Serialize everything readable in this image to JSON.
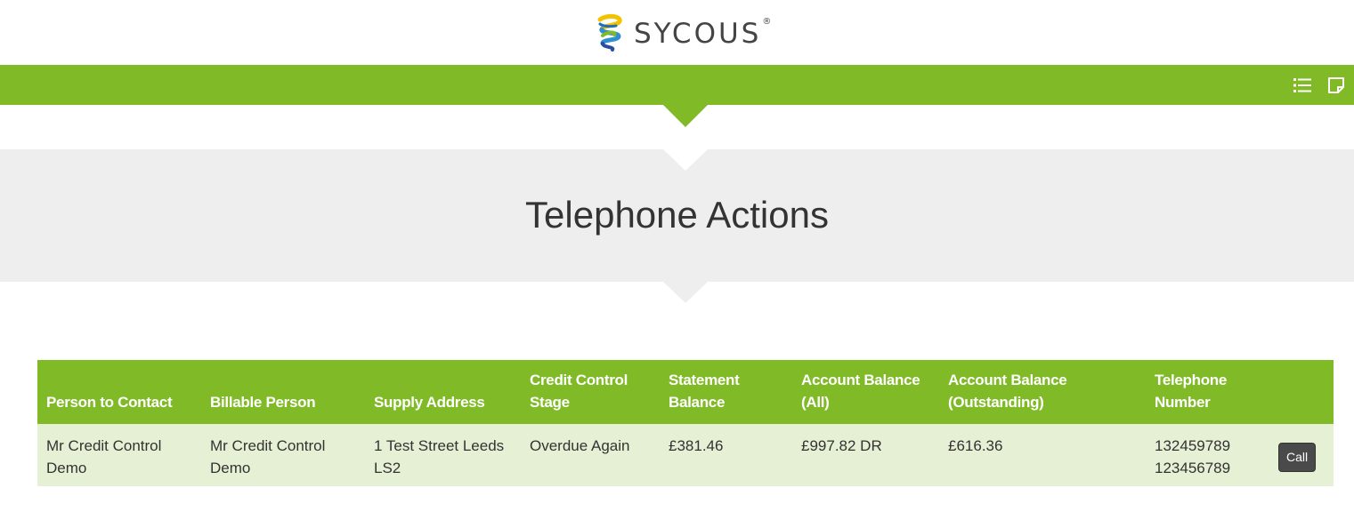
{
  "brand": {
    "name": "SYCOUS",
    "registered_mark": "®",
    "colors": {
      "green": "#80ba27",
      "band": "#eeeeee",
      "row": "#e6f0d5"
    }
  },
  "navbar": {
    "icons": [
      "list-icon",
      "note-icon"
    ]
  },
  "page": {
    "title": "Telephone Actions"
  },
  "table": {
    "columns": [
      "Person to Contact",
      "Billable Person",
      "Supply Address",
      "Credit Control Stage",
      "Statement Balance",
      "Account Balance (All)",
      "Account Balance (Outstanding)",
      "Telephone Number"
    ],
    "rows": [
      {
        "person_to_contact": "Mr Credit Control Demo",
        "billable_person": "Mr Credit Control Demo",
        "supply_address": "1 Test Street Leeds LS2",
        "credit_control_stage": "Overdue Again",
        "statement_balance": "£381.46",
        "account_balance_all": "£997.82 DR",
        "account_balance_outstanding": "£616.36",
        "telephone_1": "132459789",
        "telephone_2": "123456789",
        "call_label": "Call"
      }
    ]
  }
}
